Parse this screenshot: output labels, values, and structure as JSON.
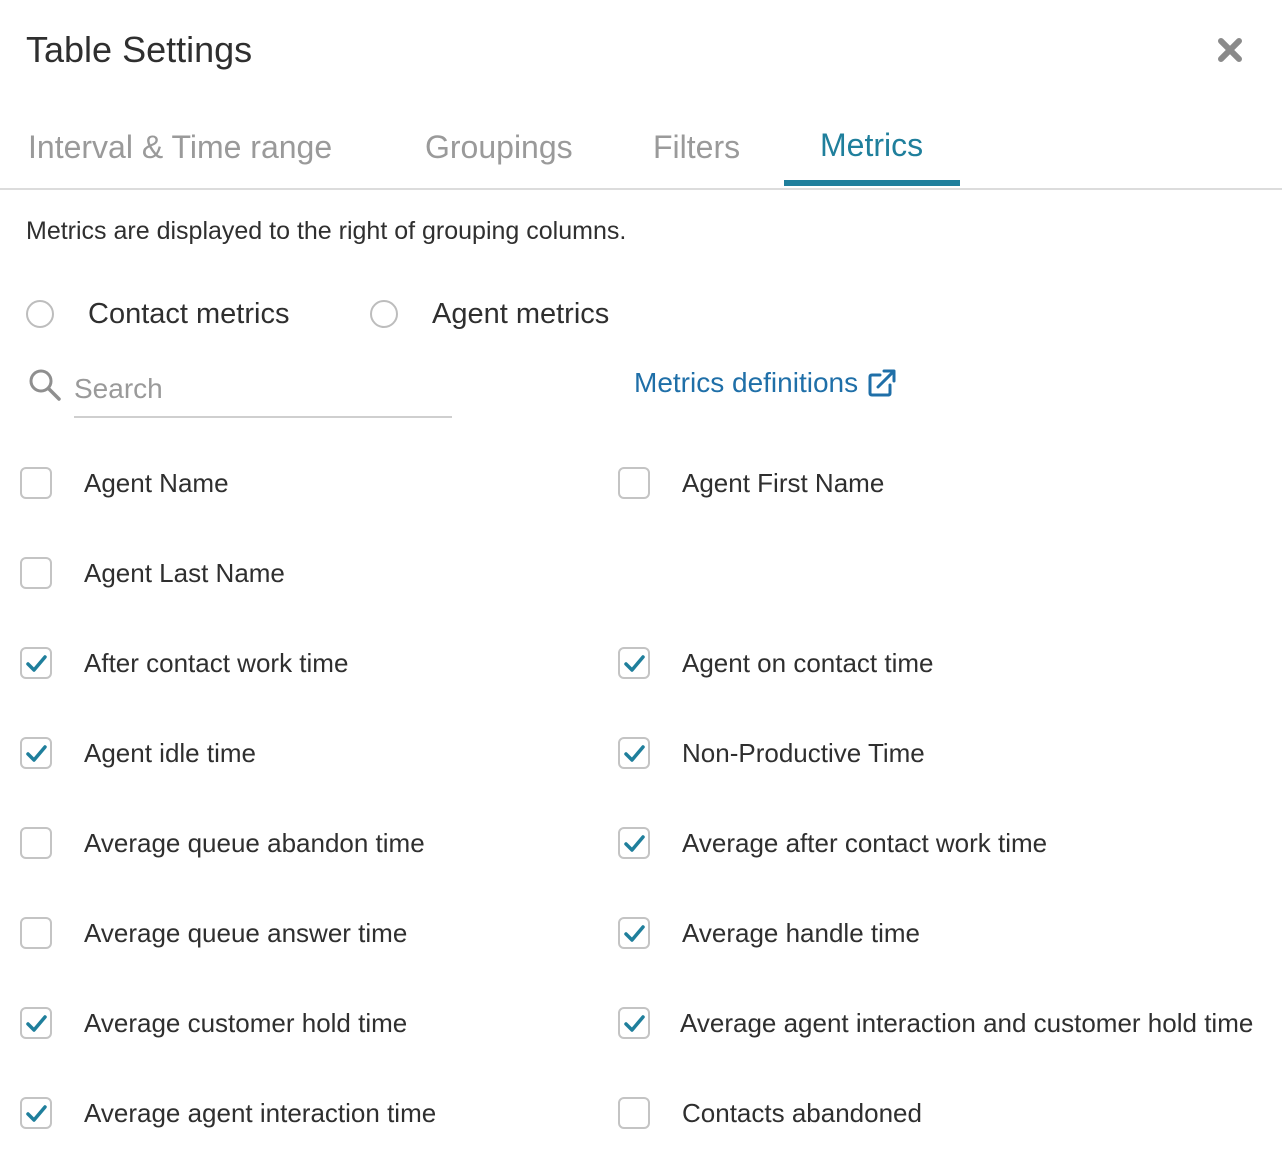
{
  "dialog": {
    "title": "Table Settings",
    "close_icon": "close-icon"
  },
  "tabs": [
    {
      "label": "Interval & Time range",
      "active": false
    },
    {
      "label": "Groupings",
      "active": false
    },
    {
      "label": "Filters",
      "active": false
    },
    {
      "label": "Metrics",
      "active": true
    }
  ],
  "metrics_panel": {
    "description": "Metrics are displayed to the right of grouping columns.",
    "radios": [
      {
        "label": "Contact metrics",
        "selected": false
      },
      {
        "label": "Agent metrics",
        "selected": false
      }
    ],
    "search": {
      "placeholder": "Search",
      "value": "",
      "icon": "search-icon"
    },
    "definitions_link": {
      "label": "Metrics definitions",
      "icon": "external-link-icon"
    },
    "items": [
      {
        "label": "Agent Name",
        "checked": false
      },
      {
        "label": "Agent First Name",
        "checked": false
      },
      {
        "label": "Agent Last Name",
        "checked": false
      },
      {
        "label": "After contact work time",
        "checked": true
      },
      {
        "label": "Agent on contact time",
        "checked": true
      },
      {
        "label": "Agent idle time",
        "checked": true
      },
      {
        "label": "Non-Productive Time",
        "checked": true
      },
      {
        "label": "Average queue abandon time",
        "checked": false
      },
      {
        "label": "Average after contact work time",
        "checked": true
      },
      {
        "label": "Average queue answer time",
        "checked": false
      },
      {
        "label": "Average handle time",
        "checked": true
      },
      {
        "label": "Average customer hold time",
        "checked": true
      },
      {
        "label": "Average agent interaction and customer hold time",
        "checked": true
      },
      {
        "label": "Average agent interaction time",
        "checked": true
      },
      {
        "label": "Contacts abandoned",
        "checked": false
      }
    ]
  },
  "colors": {
    "accent": "#1f7f9c",
    "link": "#1f6fa8",
    "text": "#2f2f2f",
    "muted": "#9a9a9a"
  }
}
